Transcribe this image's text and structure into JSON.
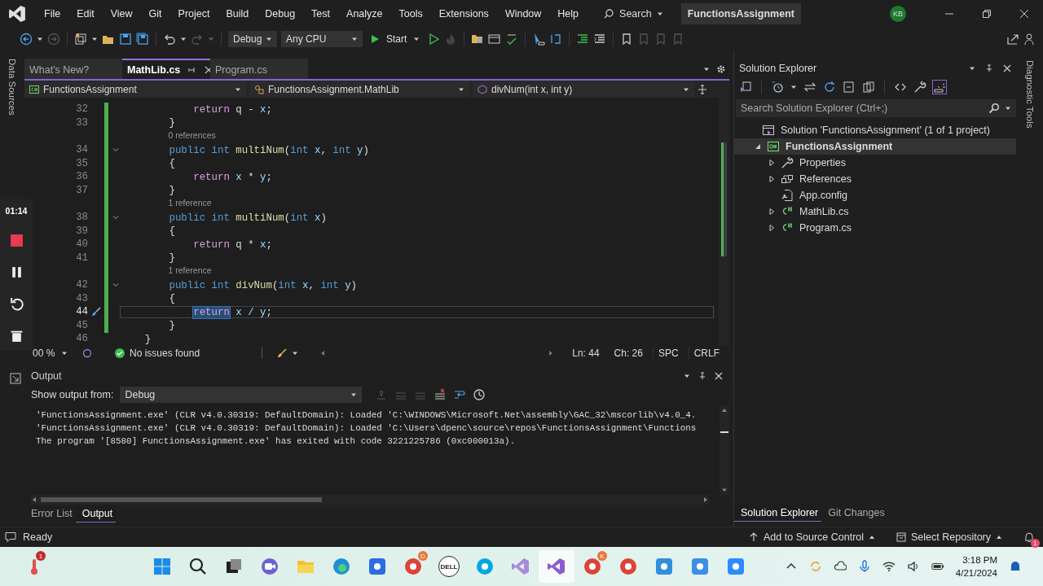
{
  "title_bar": {
    "menu": [
      "File",
      "Edit",
      "View",
      "Git",
      "Project",
      "Build",
      "Debug",
      "Test",
      "Analyze",
      "Tools",
      "Extensions",
      "Window",
      "Help"
    ],
    "search": "Search",
    "solution_name": "FunctionsAssignment",
    "avatar": "KB"
  },
  "toolbar": {
    "configuration": "Debug",
    "platform": "Any CPU",
    "start": "Start"
  },
  "left_strip": {
    "label": "Data Sources"
  },
  "right_strip": {
    "label": "Diagnostic Tools"
  },
  "recorder": {
    "time": "01:14"
  },
  "tabs": [
    {
      "label": "What's New?",
      "selected": false
    },
    {
      "label": "MathLib.cs",
      "selected": true
    },
    {
      "label": "Program.cs",
      "selected": false
    }
  ],
  "nav_bar": {
    "project": "FunctionsAssignment",
    "type": "FunctionsAssignment.MathLib",
    "member": "divNum(int x, int y)"
  },
  "editor": {
    "lines": [
      {
        "kind": "code",
        "number": "32",
        "fold": false,
        "current": false,
        "tokens": [
          {
            "text": "            return",
            "kind": "control"
          },
          {
            "text": " q - ",
            "kind": "plain"
          },
          {
            "text": "x",
            "kind": "param"
          },
          {
            "text": ";",
            "kind": "plain"
          }
        ]
      },
      {
        "kind": "code",
        "number": "33",
        "fold": false,
        "current": false,
        "tokens": [
          {
            "text": "        }",
            "kind": "plain"
          }
        ]
      },
      {
        "kind": "lens",
        "text": "0 references"
      },
      {
        "kind": "code",
        "number": "34",
        "fold": true,
        "current": false,
        "tokens": [
          {
            "text": "        public int",
            "kind": "keyword"
          },
          {
            "text": " multiNum",
            "kind": "method"
          },
          {
            "text": "(",
            "kind": "plain"
          },
          {
            "text": "int",
            "kind": "keyword"
          },
          {
            "text": " x",
            "kind": "param"
          },
          {
            "text": ", ",
            "kind": "plain"
          },
          {
            "text": "int",
            "kind": "keyword"
          },
          {
            "text": " y",
            "kind": "param"
          },
          {
            "text": ")",
            "kind": "plain"
          }
        ]
      },
      {
        "kind": "code",
        "number": "35",
        "fold": false,
        "current": false,
        "tokens": [
          {
            "text": "        {",
            "kind": "plain"
          }
        ]
      },
      {
        "kind": "code",
        "number": "36",
        "fold": false,
        "current": false,
        "tokens": [
          {
            "text": "            return",
            "kind": "control"
          },
          {
            "text": " x",
            "kind": "param"
          },
          {
            "text": " * ",
            "kind": "plain"
          },
          {
            "text": "y",
            "kind": "param"
          },
          {
            "text": ";",
            "kind": "plain"
          }
        ]
      },
      {
        "kind": "code",
        "number": "37",
        "fold": false,
        "current": false,
        "tokens": [
          {
            "text": "        }",
            "kind": "plain"
          }
        ]
      },
      {
        "kind": "lens",
        "text": "1 reference"
      },
      {
        "kind": "code",
        "number": "38",
        "fold": true,
        "current": false,
        "tokens": [
          {
            "text": "        public int",
            "kind": "keyword"
          },
          {
            "text": " multiNum",
            "kind": "method"
          },
          {
            "text": "(",
            "kind": "plain"
          },
          {
            "text": "int",
            "kind": "keyword"
          },
          {
            "text": " x",
            "kind": "param"
          },
          {
            "text": ")",
            "kind": "plain"
          }
        ]
      },
      {
        "kind": "code",
        "number": "39",
        "fold": false,
        "current": false,
        "tokens": [
          {
            "text": "        {",
            "kind": "plain"
          }
        ]
      },
      {
        "kind": "code",
        "number": "40",
        "fold": false,
        "current": false,
        "tokens": [
          {
            "text": "            return",
            "kind": "control"
          },
          {
            "text": " q * ",
            "kind": "plain"
          },
          {
            "text": "x",
            "kind": "param"
          },
          {
            "text": ";",
            "kind": "plain"
          }
        ]
      },
      {
        "kind": "code",
        "number": "41",
        "fold": false,
        "current": false,
        "tokens": [
          {
            "text": "        }",
            "kind": "plain"
          }
        ]
      },
      {
        "kind": "lens",
        "text": "1 reference"
      },
      {
        "kind": "code",
        "number": "42",
        "fold": true,
        "current": false,
        "tokens": [
          {
            "text": "        public int",
            "kind": "keyword"
          },
          {
            "text": " divNum",
            "kind": "method"
          },
          {
            "text": "(",
            "kind": "plain"
          },
          {
            "text": "int",
            "kind": "keyword"
          },
          {
            "text": " x",
            "kind": "param"
          },
          {
            "text": ", ",
            "kind": "plain"
          },
          {
            "text": "int",
            "kind": "keyword"
          },
          {
            "text": " y",
            "kind": "param"
          },
          {
            "text": ")",
            "kind": "plain"
          }
        ]
      },
      {
        "kind": "code",
        "number": "43",
        "fold": false,
        "current": false,
        "tokens": [
          {
            "text": "        {",
            "kind": "plain"
          }
        ]
      },
      {
        "kind": "code",
        "number": "44",
        "fold": false,
        "current": true,
        "tokens": [
          {
            "text": "            return",
            "kind": "control-selected"
          },
          {
            "text": " x / ",
            "kind": "param"
          },
          {
            "text": "y",
            "kind": "param"
          },
          {
            "text": ";",
            "kind": "plain"
          }
        ]
      },
      {
        "kind": "code",
        "number": "45",
        "fold": false,
        "current": false,
        "tokens": [
          {
            "text": "        }",
            "kind": "plain"
          }
        ]
      },
      {
        "kind": "code",
        "number": "46",
        "fold": false,
        "current": false,
        "tokens": [
          {
            "text": "    }",
            "kind": "plain"
          }
        ]
      }
    ]
  },
  "editor_status": {
    "zoom": "00 %",
    "issues": "No issues found",
    "line": "Ln: 44",
    "column": "Ch: 26",
    "whitespace": "SPC",
    "line_endings": "CRLF"
  },
  "output": {
    "title": "Output",
    "source_label": "Show output from:",
    "source": "Debug",
    "lines": [
      "'FunctionsAssignment.exe' (CLR v4.0.30319: DefaultDomain): Loaded 'C:\\WINDOWS\\Microsoft.Net\\assembly\\GAC_32\\mscorlib\\v4.0_4.",
      "'FunctionsAssignment.exe' (CLR v4.0.30319: DefaultDomain): Loaded 'C:\\Users\\dpenc\\source\\repos\\FunctionsAssignment\\Functions",
      "The program '[8580] FunctionsAssignment.exe' has exited with code 3221225786 (0xc000013a)."
    ]
  },
  "bottom_tabs": [
    {
      "label": "Error List",
      "selected": false
    },
    {
      "label": "Output",
      "selected": true
    }
  ],
  "solution_explorer": {
    "title": "Solution Explorer",
    "search_placeholder": "Search Solution Explorer (Ctrl+;)",
    "tree": [
      {
        "label": "Solution 'FunctionsAssignment' (1 of 1 project)",
        "kind": "solution",
        "selected": false,
        "children": [
          {
            "label": "FunctionsAssignment",
            "kind": "project",
            "expanded": true,
            "selected": true,
            "children": [
              {
                "label": "Properties",
                "kind": "properties",
                "expanded": false,
                "selected": false
              },
              {
                "label": "References",
                "kind": "references",
                "expanded": false,
                "selected": false
              },
              {
                "label": "App.config",
                "kind": "config",
                "selected": false
              },
              {
                "label": "MathLib.cs",
                "kind": "csharp",
                "expanded": false,
                "selected": false
              },
              {
                "label": "Program.cs",
                "kind": "csharp",
                "expanded": false,
                "selected": false
              }
            ]
          }
        ]
      }
    ],
    "tabs": [
      {
        "label": "Solution Explorer",
        "selected": true
      },
      {
        "label": "Git Changes",
        "selected": false
      }
    ]
  },
  "status_bar": {
    "state": "Ready",
    "source_control": "Add to Source Control",
    "repository": "Select Repository",
    "notifications": "1"
  },
  "taskbar": {
    "apps": [
      {
        "kind": "weather",
        "badge": "1",
        "selected": false
      },
      {
        "kind": "start",
        "selected": false
      },
      {
        "kind": "search",
        "selected": false
      },
      {
        "kind": "taskview",
        "selected": false
      },
      {
        "kind": "chat",
        "selected": false
      },
      {
        "kind": "folder",
        "selected": false
      },
      {
        "kind": "edge",
        "selected": false
      },
      {
        "kind": "store",
        "selected": false
      },
      {
        "kind": "chrome",
        "badge": "D",
        "selected": false
      },
      {
        "kind": "dell",
        "label": "DELL",
        "selected": false
      },
      {
        "kind": "alexa",
        "selected": false
      },
      {
        "kind": "vs-installer",
        "selected": false
      },
      {
        "kind": "vs",
        "selected": true
      },
      {
        "kind": "chrome",
        "badge": "K",
        "selected": false
      },
      {
        "kind": "chrome",
        "selected": false
      },
      {
        "kind": "notepad",
        "selected": false
      },
      {
        "kind": "photos",
        "selected": false
      },
      {
        "kind": "zoom",
        "selected": false
      }
    ],
    "time": "3:18 PM",
    "date": "4/21/2024"
  }
}
